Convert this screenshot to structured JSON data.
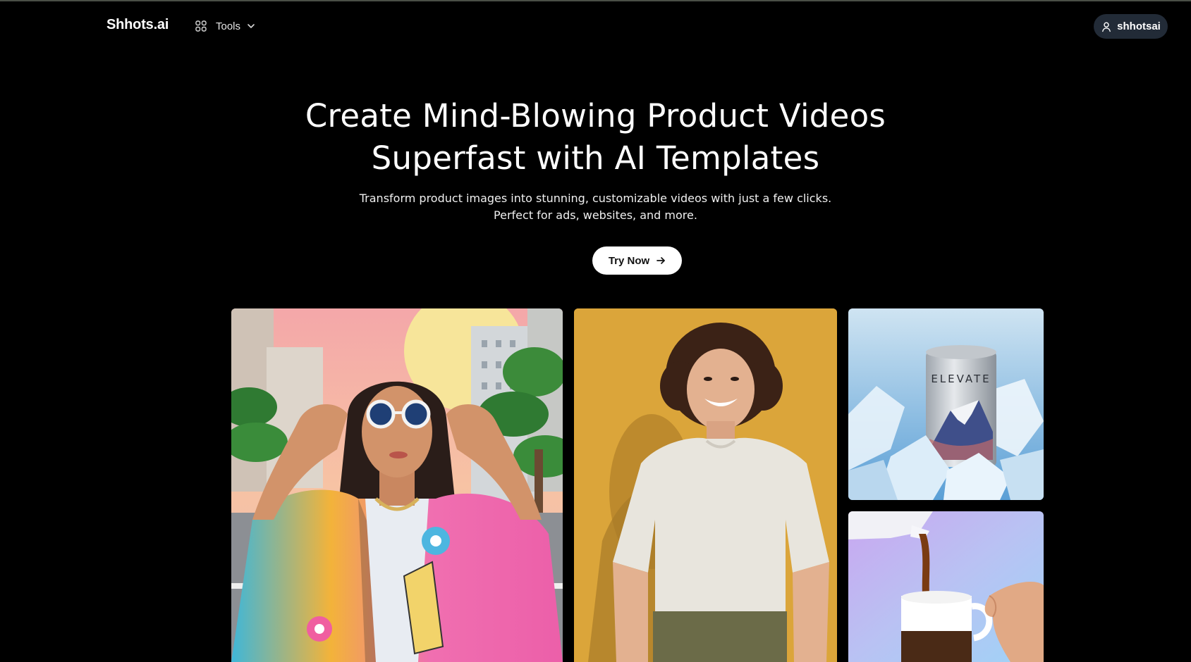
{
  "header": {
    "logo": "Shhots.ai",
    "tools_label": "Tools",
    "user_label": "shhotsai"
  },
  "hero": {
    "title_line1": "Create Mind-Blowing Product Videos",
    "title_line2": "Superfast with AI Templates",
    "subtitle_line1": "Transform product images into stunning, customizable videos with just a few clicks.",
    "subtitle_line2": "Perfect for ads, websites, and more.",
    "cta_label": "Try Now"
  },
  "gallery": {
    "tiles": [
      {
        "icon": "woman-sunglasses-image"
      },
      {
        "icon": "woman-tshirt-image"
      },
      {
        "icon": "can-on-ice-image"
      },
      {
        "icon": "coffee-pour-image"
      }
    ],
    "can_brand": "ELEVATE"
  },
  "colors": {
    "background": "#000000",
    "user_button": "#222b37",
    "cta_background": "#ffffff"
  }
}
